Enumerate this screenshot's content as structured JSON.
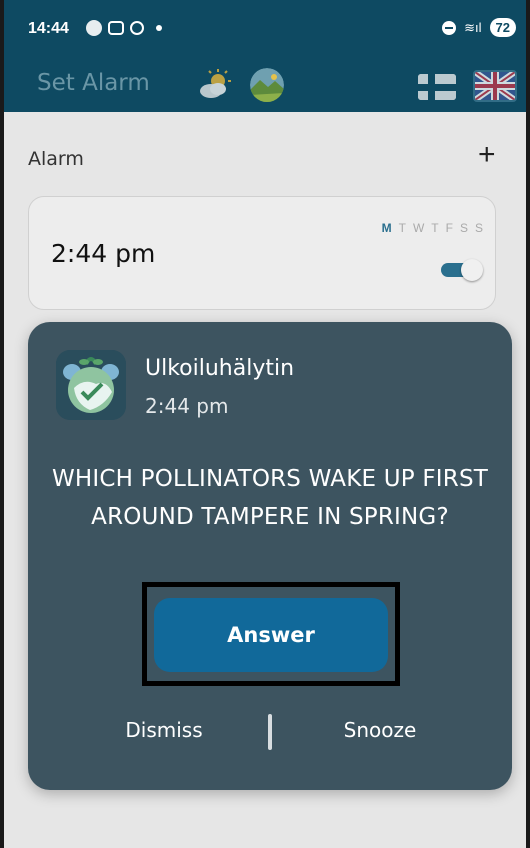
{
  "status_bar": {
    "time": "14:44",
    "battery": "72",
    "wifi_glyph": "≋ıl"
  },
  "app_bar": {
    "title": "Set Alarm",
    "icons": [
      "weather-sun-cloud-icon",
      "landscape-icon",
      "finland-flag-icon",
      "uk-flag-icon"
    ]
  },
  "alarms": {
    "header": "Alarm",
    "add_label": "+",
    "card": {
      "time": "2:44 pm",
      "days": [
        "M",
        "T",
        "W",
        "T",
        "F",
        "S",
        "S"
      ],
      "active_day_index": 0,
      "enabled": true
    }
  },
  "notification": {
    "app_name": "Ulkoiluhälytin",
    "time": "2:44 pm",
    "question": "WHICH POLLINATORS WAKE UP FIRST AROUND TAMPERE IN SPRING?",
    "answer_label": "Answer",
    "dismiss_label": "Dismiss",
    "snooze_label": "Snooze"
  },
  "colors": {
    "app_bar": "#0e4a62",
    "notification_bg": "#3d5460",
    "answer_button": "#11699a",
    "toggle_on": "#2a6f8e"
  }
}
